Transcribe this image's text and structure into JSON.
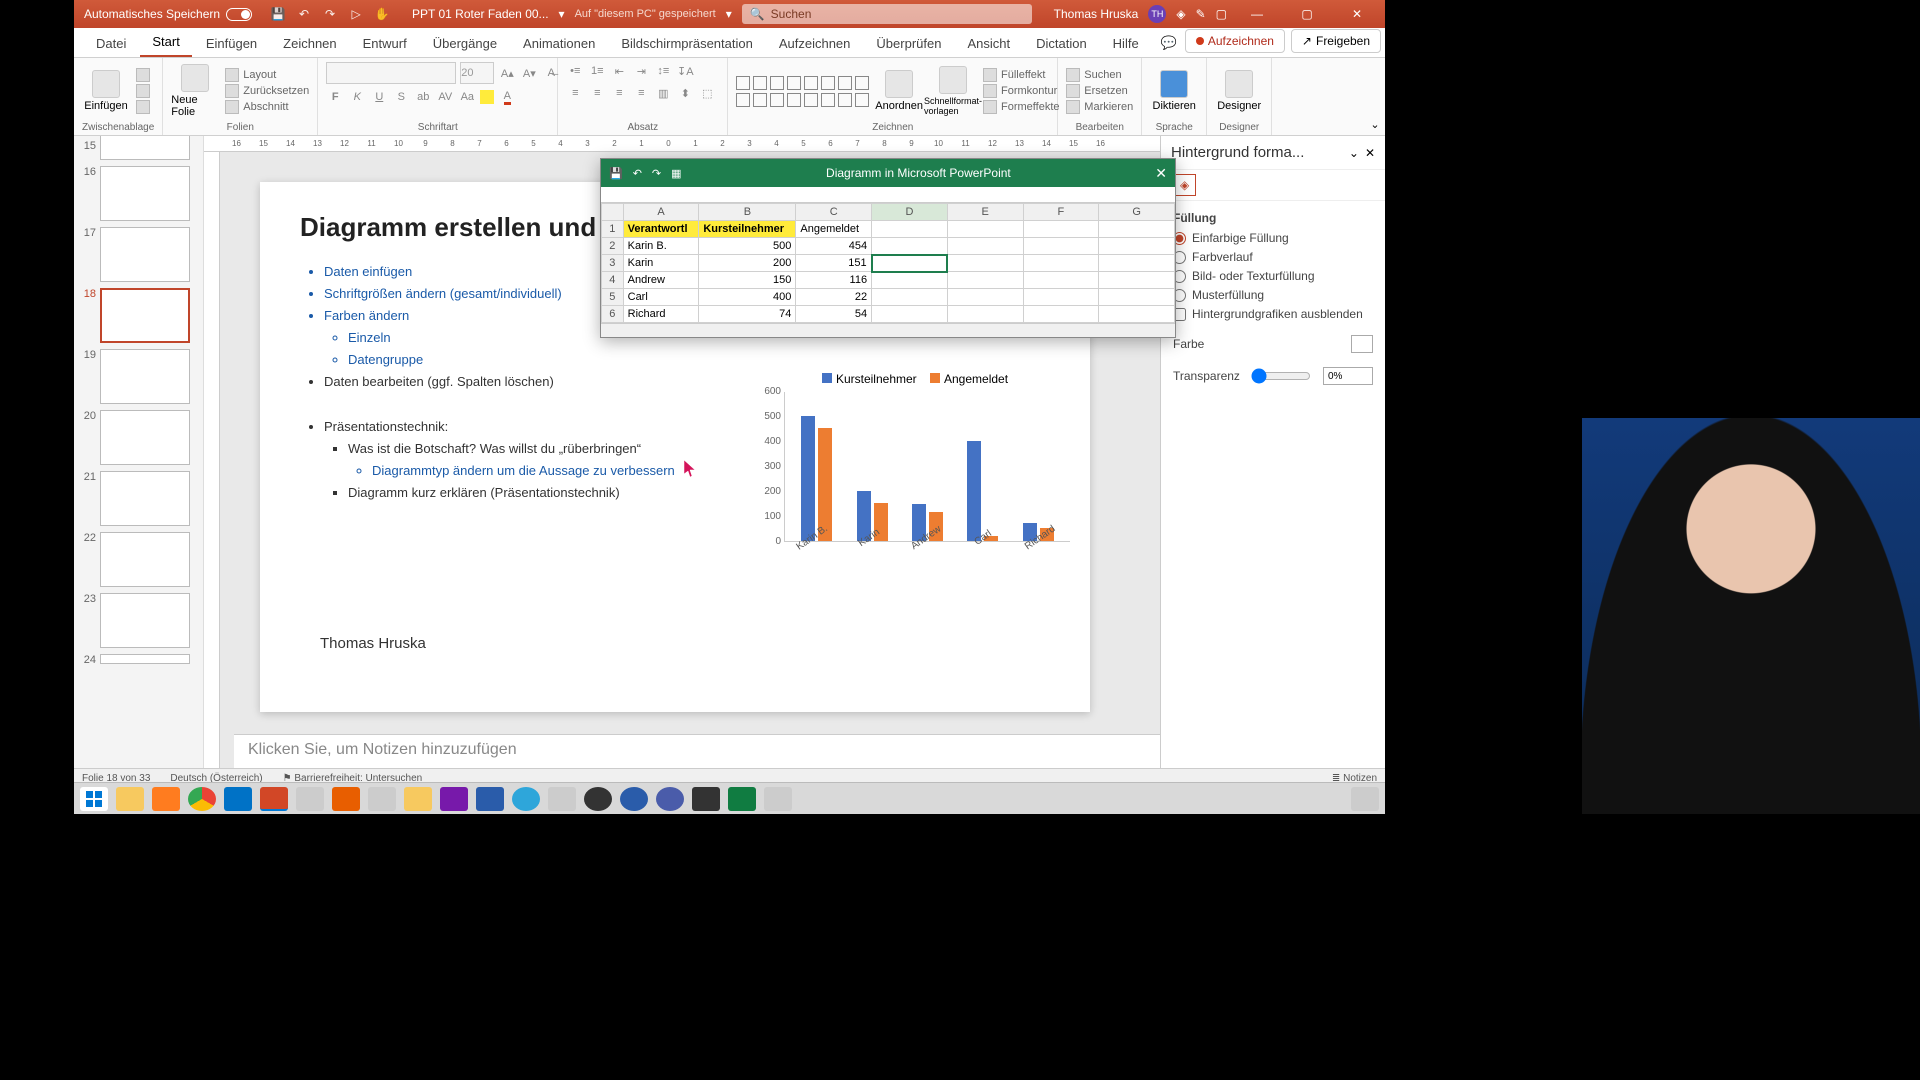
{
  "titlebar": {
    "autosave_label": "Automatisches Speichern",
    "filename": "PPT 01 Roter Faden 00...",
    "saved_hint": "Auf \"diesem PC\" gespeichert",
    "search_placeholder": "Suchen",
    "user_name": "Thomas Hruska",
    "user_initials": "TH"
  },
  "tabs": {
    "items": [
      "Datei",
      "Start",
      "Einfügen",
      "Zeichnen",
      "Entwurf",
      "Übergänge",
      "Animationen",
      "Bildschirmpräsentation",
      "Aufzeichnen",
      "Überprüfen",
      "Ansicht",
      "Dictation",
      "Hilfe"
    ],
    "active": "Start",
    "record_btn": "Aufzeichnen",
    "share_btn": "Freigeben"
  },
  "ribbon": {
    "clipboard": {
      "paste": "Einfügen",
      "label": "Zwischenablage"
    },
    "slides": {
      "new": "Neue Folie",
      "layout": "Layout",
      "reset": "Zurücksetzen",
      "section": "Abschnitt",
      "label": "Folien"
    },
    "font": {
      "size": "20",
      "label": "Schriftart"
    },
    "paragraph": {
      "label": "Absatz"
    },
    "drawing": {
      "arrange": "Anordnen",
      "quickstyles": "Schnellformat-vorlagen",
      "fill": "Fülleffekt",
      "outline": "Formkontur",
      "effects": "Formeffekte",
      "label": "Zeichnen"
    },
    "editing": {
      "find": "Suchen",
      "replace": "Ersetzen",
      "select": "Markieren",
      "label": "Bearbeiten"
    },
    "voice": {
      "dictate": "Diktieren",
      "label": "Sprache"
    },
    "designer": {
      "btn": "Designer",
      "label": "Designer"
    }
  },
  "thumbs": {
    "numbers": [
      "15",
      "16",
      "17",
      "18",
      "19",
      "20",
      "21",
      "22",
      "23",
      "24"
    ],
    "active": "18"
  },
  "ruler": [
    "16",
    "15",
    "14",
    "13",
    "12",
    "11",
    "10",
    "9",
    "8",
    "7",
    "6",
    "5",
    "4",
    "3",
    "2",
    "1",
    "0",
    "1",
    "2",
    "3",
    "4",
    "5",
    "6",
    "7",
    "8",
    "9",
    "10",
    "11",
    "12",
    "13",
    "14",
    "15",
    "16"
  ],
  "slide": {
    "title": "Diagramm erstellen und formatieren",
    "b1": "Daten einfügen",
    "b2": "Schriftgrößen ändern (gesamt/individuell)",
    "b3": "Farben ändern",
    "b3a": "Einzeln",
    "b3b": "Datengruppe",
    "b4": "Daten bearbeiten (ggf. Spalten löschen)",
    "p_title": "Präsentationstechnik:",
    "p1": "Was ist die Botschaft? Was willst du „rüberbringen“",
    "p1a": "Diagrammtyp ändern um die Aussage zu verbessern",
    "p2": "Diagramm kurz erklären (Präsentationstechnik)",
    "signature": "Thomas Hruska"
  },
  "notes_placeholder": "Klicken Sie, um Notizen hinzuzufügen",
  "statusbar": {
    "slide": "Folie 18 von 33",
    "lang": "Deutsch (Österreich)",
    "a11y": "Barrierefreiheit: Untersuchen",
    "notes": "Notizen"
  },
  "pane": {
    "title": "Hintergrund forma...",
    "section": "Füllung",
    "o1": "Einfarbige Füllung",
    "o2": "Farbverlauf",
    "o3": "Bild- oder Texturfüllung",
    "o4": "Musterfüllung",
    "o5": "Hintergrundgrafiken ausblenden",
    "color_label": "Farbe",
    "transp_label": "Transparenz",
    "transp_value": "0%"
  },
  "sheet": {
    "title": "Diagramm in Microsoft PowerPoint",
    "cols": [
      "A",
      "B",
      "C",
      "D",
      "E",
      "F",
      "G"
    ],
    "h1": "Verantwortl",
    "h2": "Kursteilnehmer",
    "h3": "Angemeldet",
    "rows": [
      {
        "n": "1"
      },
      {
        "n": "2",
        "a": "Karin B.",
        "b": "500",
        "c": "454"
      },
      {
        "n": "3",
        "a": "Karin",
        "b": "200",
        "c": "151"
      },
      {
        "n": "4",
        "a": "Andrew",
        "b": "150",
        "c": "116"
      },
      {
        "n": "5",
        "a": "Carl",
        "b": "400",
        "c": "22"
      },
      {
        "n": "6",
        "a": "Richard",
        "b": "74",
        "c": "54"
      }
    ]
  },
  "chart_data": {
    "type": "bar",
    "title": "",
    "categories": [
      "Karin B.",
      "Karin",
      "Andrew",
      "Carl",
      "Richard"
    ],
    "series": [
      {
        "name": "Kursteilnehmer",
        "color": "#4472c4",
        "values": [
          500,
          200,
          150,
          400,
          74
        ]
      },
      {
        "name": "Angemeldet",
        "color": "#ed7d31",
        "values": [
          454,
          151,
          116,
          22,
          54
        ]
      }
    ],
    "ylim": [
      0,
      600
    ],
    "ytick": [
      0,
      100,
      200,
      300,
      400,
      500,
      600
    ],
    "xlabel": "",
    "ylabel": ""
  }
}
